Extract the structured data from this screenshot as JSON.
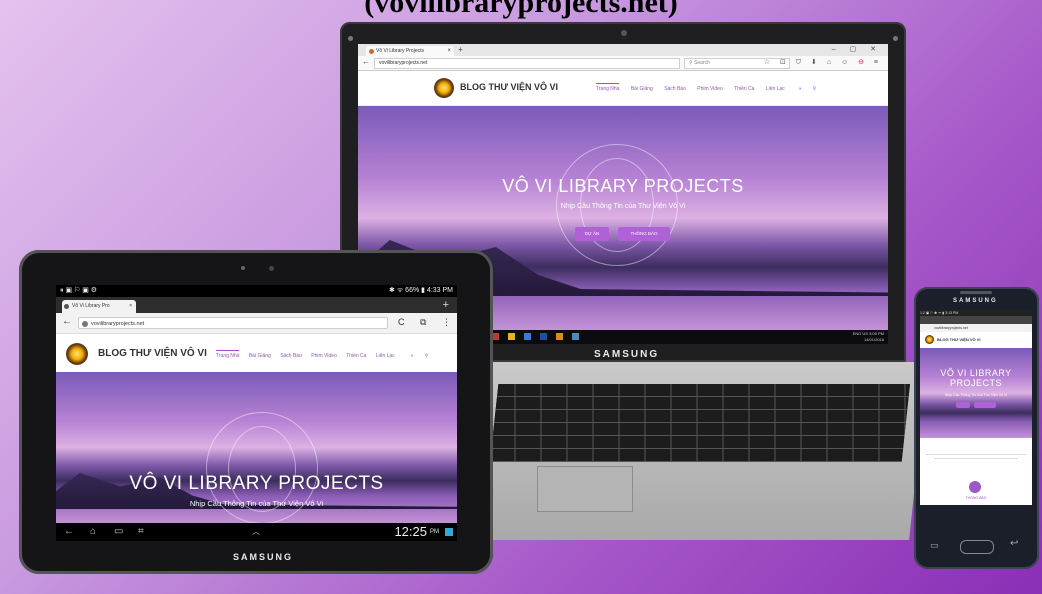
{
  "page_title": "(vovilibraryprojects.net)",
  "laptop": {
    "brand": "SAMSUNG",
    "browser_tab": "Vô Vi Library Projects",
    "tab_close": "×",
    "new_tab": "+",
    "url": "vovilibraryprojects.net",
    "search_placeholder": "Search",
    "window_controls": "–  ▢  ✕",
    "toolbar_icons": "☆ ⊡ ⛉ ⬇ ⌂ ☺",
    "toolbar_badge": "⊖",
    "menu_icon": "≡",
    "taskbar_time": "3:05 PM",
    "taskbar_date": "14/01/2016",
    "taskbar_lang": "ENG US"
  },
  "site": {
    "brand": "BLOG THƯ VIỆN VÔ VI",
    "menu": [
      "Trang Nhà",
      "Bài Giảng",
      "Sách Báo",
      "Phim Video",
      "Thiền Ca",
      "Liên Lạc"
    ],
    "active_menu_index": 0,
    "hero_title": "VÔ VI LIBRARY PROJECTS",
    "hero_subtitle": "Nhịp Cầu Thông Tin của Thư Viện Vô Vi",
    "button_projects": "DỰ ÁN",
    "button_notice": "THÔNG BÁO",
    "moon_icon": "◑",
    "search_icon": "⚲"
  },
  "tablet": {
    "brand": "SAMSUNG",
    "status_left": "⏸ ▣ ⚐ ▣ ⚙",
    "status_right": "✱ ᯤ 66% ▮ 4:33 PM",
    "browser_tab": "Vô Vi Library Pro",
    "tab_close": "×",
    "new_tab": "+",
    "url": "vovilibraryprojects.net",
    "reload": "C",
    "tabs_icon": "⧉",
    "menu_icon": "⋮",
    "nav_back": "←",
    "nav_home": "⌂",
    "nav_recent": "▭",
    "nav_screenshot": "⌗",
    "nav_up": "︿",
    "clock": "12:25",
    "clock_ampm": "PM"
  },
  "phone": {
    "brand": "SAMSUNG",
    "status": "1:2 ▣ ⚐        ✱ ᯤ ▮ 3:13 PM",
    "url": "vovilibraryprojects.net",
    "hero_title": "VÔ VI LIBRARY PROJECTS",
    "hero_subtitle": "Nhịp Cầu Thông Tin của Thư Viện Vô Vi",
    "notice_label": "THÔNG BÁO",
    "nav_back": "↩"
  },
  "colors": {
    "accent": "#a050d0",
    "button": "#b061d8",
    "background_start": "#e4c2ee",
    "background_end": "#8a2fb6"
  }
}
